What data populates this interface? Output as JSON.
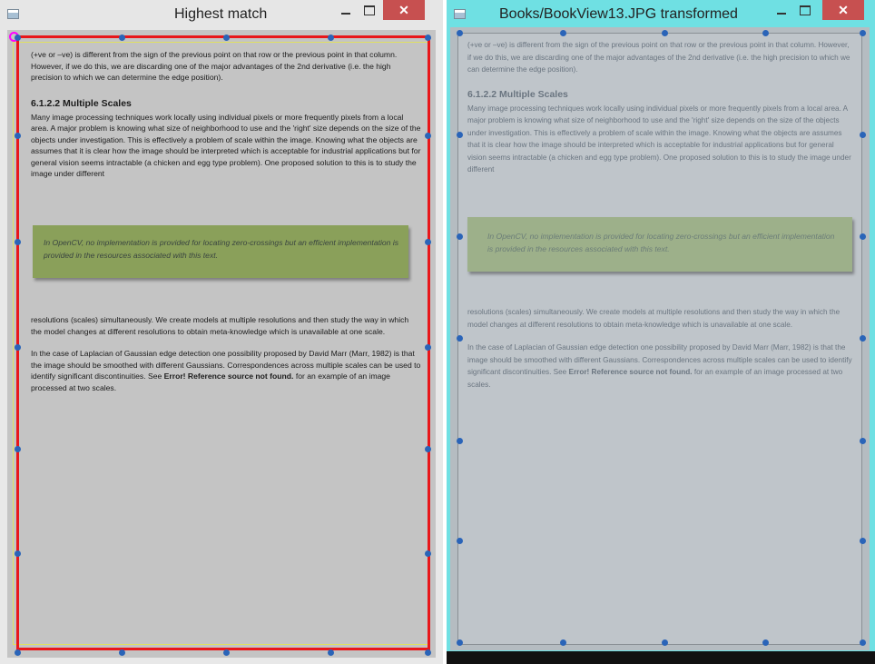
{
  "left_window": {
    "title": "Highest match",
    "controls": {
      "minimize": "minimize",
      "maximize": "maximize",
      "close": "✕"
    }
  },
  "right_window": {
    "title": "Books/BookView13.JPG transformed",
    "controls": {
      "minimize": "minimize",
      "maximize": "maximize",
      "close": "✕"
    }
  },
  "document": {
    "intro": "(+ve or –ve) is different from the sign of the previous point on that row or the previous point in that column. However, if we do this, we are discarding one of the major advantages of the 2nd derivative (i.e. the high precision to which we can determine the edge position).",
    "heading": "6.1.2.2 Multiple Scales",
    "para1": "Many image processing techniques work locally using individual pixels or more frequently pixels from a local area. A major problem is knowing what size of neighborhood to use and the 'right' size depends on the size of the objects under investigation. This is effectively a problem of scale within the image. Knowing what the objects are assumes that it is clear how the image should be interpreted which is acceptable for industrial applications but for general vision seems intractable (a chicken and egg type problem). One proposed solution to this is to study the image under different",
    "note": "In OpenCV, no implementation is provided for locating zero-crossings but an efficient implementation is provided in the resources associated with this text.",
    "para2": "resolutions (scales) simultaneously. We create models at multiple resolutions and then study the way in which the model changes at different resolutions to obtain meta-knowledge which is unavailable at one scale.",
    "para3_start": "In the case of Laplacian of Gaussian edge detection one possibility proposed by David Marr (Marr, 1982) is that the image should be smoothed with different Gaussians. Correspondences across multiple scales can be used to identify significant discontinuities. See ",
    "para3_bold": "Error! Reference source not found.",
    "para3_end": " for an example of an image processed at two scales."
  },
  "colors": {
    "left_titlebar": "#e6e6e6",
    "right_titlebar": "#6fe0e3",
    "close_button": "#c75050",
    "match_rect": "#e8161a",
    "point_marker": "#2a64b8",
    "corner_marker": "#ff00ff",
    "note_highlight": "#8aa05a"
  }
}
